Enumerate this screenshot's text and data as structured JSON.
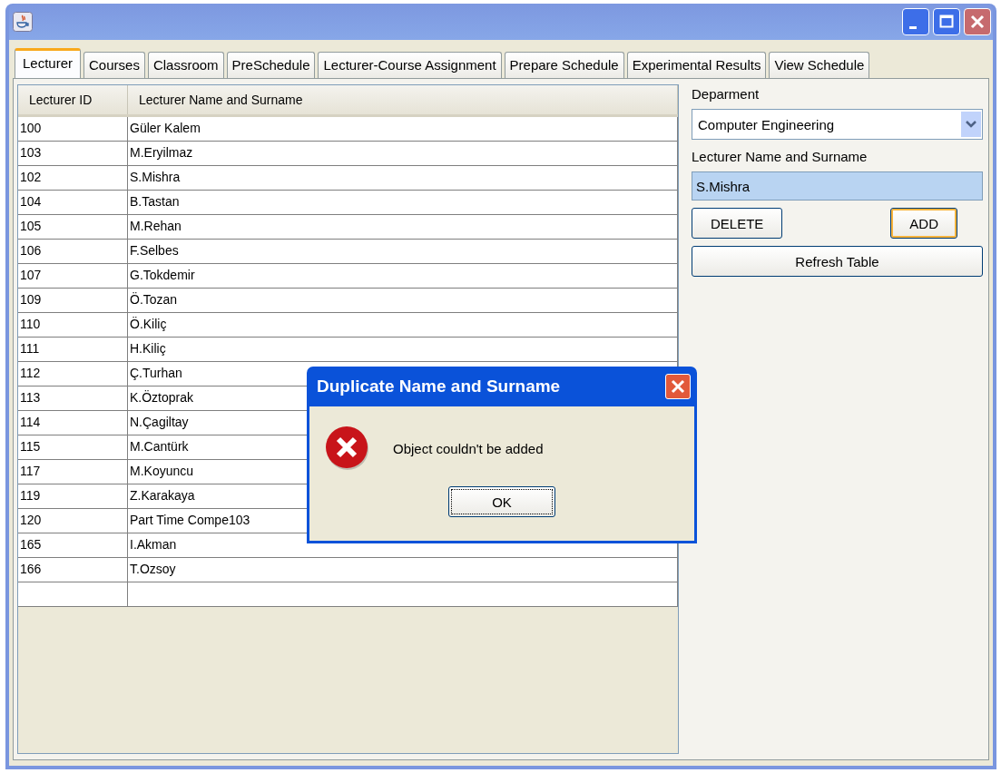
{
  "tabs": [
    {
      "label": "Lecturer",
      "selected": true
    },
    {
      "label": "Courses",
      "selected": false
    },
    {
      "label": "Classroom",
      "selected": false
    },
    {
      "label": "PreSchedule",
      "selected": false
    },
    {
      "label": "Lecturer-Course Assignment",
      "selected": false
    },
    {
      "label": "Prepare Schedule",
      "selected": false
    },
    {
      "label": "Experimental Results",
      "selected": false
    },
    {
      "label": "View Schedule",
      "selected": false
    }
  ],
  "table": {
    "columns": [
      "Lecturer ID",
      "Lecturer Name and Surname"
    ],
    "rows": [
      [
        "100",
        "Güler Kalem"
      ],
      [
        "103",
        "M.Eryilmaz"
      ],
      [
        "102",
        "S.Mishra"
      ],
      [
        "104",
        "B.Tastan"
      ],
      [
        "105",
        "M.Rehan"
      ],
      [
        "106",
        "F.Selbes"
      ],
      [
        "107",
        "G.Tokdemir"
      ],
      [
        "109",
        "Ö.Tozan"
      ],
      [
        "110",
        "Ö.Kiliç"
      ],
      [
        "111",
        "H.Kiliç"
      ],
      [
        "112",
        "Ç.Turhan"
      ],
      [
        "113",
        "K.Öztoprak"
      ],
      [
        "114",
        "N.Çagiltay"
      ],
      [
        "115",
        "M.Cantürk"
      ],
      [
        "117",
        "M.Koyuncu"
      ],
      [
        "119",
        "Z.Karakaya"
      ],
      [
        "120",
        "Part Time Compe103"
      ],
      [
        "165",
        "I.Akman"
      ],
      [
        "166",
        "T.Ozsoy"
      ]
    ]
  },
  "form": {
    "department_label": "Deparment",
    "department_value": "Computer Engineering",
    "name_label": "Lecturer Name and Surname",
    "name_value": "S.Mishra",
    "buttons": [
      {
        "label": "DELETE",
        "focused": false,
        "kind": "half"
      },
      {
        "label": "ADD",
        "focused": true,
        "kind": "half"
      },
      {
        "label": "Refresh Table",
        "focused": false,
        "kind": "wide"
      }
    ]
  },
  "dialog": {
    "title": "Duplicate Name and Surname",
    "message": "Object couldn't be added",
    "button": "OK"
  }
}
